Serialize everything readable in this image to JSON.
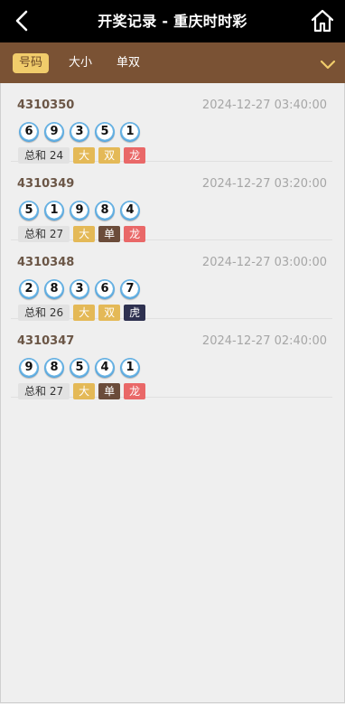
{
  "header": {
    "title": "开奖记录 - 重庆时时彩",
    "back_icon": "chevron-left-icon",
    "home_icon": "home-icon"
  },
  "tabs": [
    {
      "label": "号码",
      "active": true
    },
    {
      "label": "大小",
      "active": false
    },
    {
      "label": "单双",
      "active": false
    }
  ],
  "tabs_expand_icon": "chevron-down-icon",
  "colors": {
    "accent": "#f1cc6b",
    "tabbar": "#7a5234",
    "header": "#000000",
    "dragon": "#e96868",
    "tiger": "#2e3150",
    "odd": "#6b4c3a",
    "big_even": "#e4b957"
  },
  "draws": [
    {
      "issue": "4310350",
      "time": "2024-12-27 03:40:00",
      "balls": [
        "6",
        "9",
        "3",
        "5",
        "1"
      ],
      "sum": "总和 24",
      "size": "大",
      "parity": "双",
      "dt": "龙"
    },
    {
      "issue": "4310349",
      "time": "2024-12-27 03:20:00",
      "balls": [
        "5",
        "1",
        "9",
        "8",
        "4"
      ],
      "sum": "总和 27",
      "size": "大",
      "parity": "单",
      "dt": "龙"
    },
    {
      "issue": "4310348",
      "time": "2024-12-27 03:00:00",
      "balls": [
        "2",
        "8",
        "3",
        "6",
        "7"
      ],
      "sum": "总和 26",
      "size": "大",
      "parity": "双",
      "dt": "虎"
    },
    {
      "issue": "4310347",
      "time": "2024-12-27 02:40:00",
      "balls": [
        "9",
        "8",
        "5",
        "4",
        "1"
      ],
      "sum": "总和 27",
      "size": "大",
      "parity": "单",
      "dt": "龙"
    }
  ]
}
